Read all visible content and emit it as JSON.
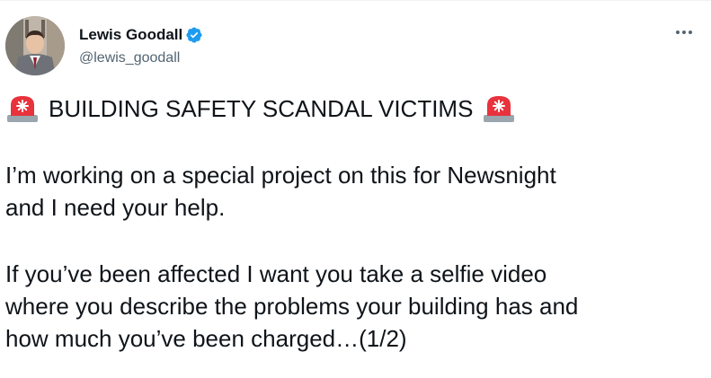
{
  "author": {
    "name": "Lewis Goodall",
    "handle": "@lewis_goodall",
    "verified_icon": "verified-badge-icon",
    "avatar": "profile-photo"
  },
  "menu": {
    "icon": "more-horizontal-icon"
  },
  "tweet": {
    "headline": "BUILDING SAFETY SCANDAL VICTIMS",
    "headline_emoji": "police-car-light-emoji",
    "paragraph1": [
      "I’m working on a special project on this for Newsnight",
      "and I need your help."
    ],
    "paragraph2": [
      "If you’ve been affected I want you take a selfie video",
      "where you describe the problems your building has and",
      "how much you’ve been charged…(1/2)"
    ]
  },
  "colors": {
    "text": "#0f1419",
    "secondary": "#536471",
    "verified": "#1d9bf0",
    "siren_red": "#e8323c",
    "siren_base": "#9aa5ad"
  }
}
